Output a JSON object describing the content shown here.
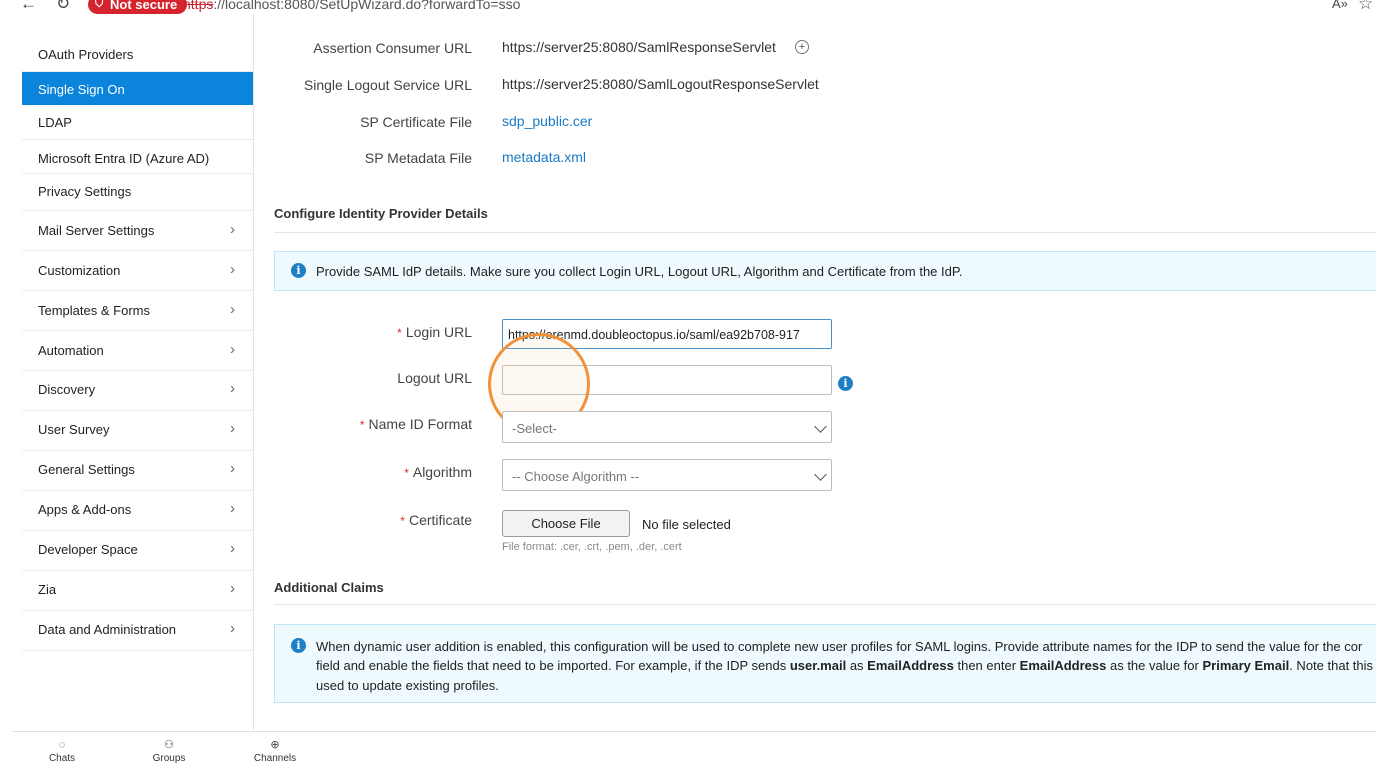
{
  "browser": {
    "security_badge": "Not secure",
    "url_scheme": "https",
    "url_rest": "://localhost:8080/SetUpWizard.do?forwardTo=sso"
  },
  "sidebar": {
    "items": [
      {
        "label": "OAuth Providers"
      },
      {
        "label": "Single Sign On",
        "active": true
      },
      {
        "label": "LDAP"
      },
      {
        "label": "Microsoft Entra ID (Azure AD)"
      },
      {
        "label": "Privacy Settings"
      },
      {
        "label": "Mail Server Settings",
        "expandable": true
      },
      {
        "label": "Customization",
        "expandable": true
      },
      {
        "label": "Templates & Forms",
        "expandable": true
      },
      {
        "label": "Automation",
        "expandable": true
      },
      {
        "label": "Discovery",
        "expandable": true
      },
      {
        "label": "User Survey",
        "expandable": true
      },
      {
        "label": "General Settings",
        "expandable": true
      },
      {
        "label": "Apps & Add-ons",
        "expandable": true
      },
      {
        "label": "Developer Space",
        "expandable": true
      },
      {
        "label": "Zia",
        "expandable": true
      },
      {
        "label": "Data and Administration",
        "expandable": true
      }
    ]
  },
  "sp_details": {
    "acs_label": "Assertion Consumer URL",
    "acs_value": "https://server25:8080/SamlResponseServlet",
    "slo_label": "Single Logout Service URL",
    "slo_value": "https://server25:8080/SamlLogoutResponseServlet",
    "cert_label": "SP Certificate File",
    "cert_link": "sdp_public.cer",
    "metadata_label": "SP Metadata File",
    "metadata_link": "metadata.xml"
  },
  "idp": {
    "section_title": "Configure Identity Provider Details",
    "info": "Provide SAML IdP details. Make sure you collect Login URL, Logout URL, Algorithm and Certificate from the IdP.",
    "login_url_label": "Login URL",
    "login_url_value": "https://orenmd.doubleoctopus.io/saml/ea92b708-917",
    "logout_url_label": "Logout URL",
    "logout_url_value": "",
    "name_id_label": "Name ID Format",
    "name_id_value": "-Select-",
    "algorithm_label": "Algorithm",
    "algorithm_value": "-- Choose Algorithm --",
    "certificate_label": "Certificate",
    "choose_file_label": "Choose File",
    "no_file_text": "No file selected",
    "file_format_hint": "File format: .cer, .crt, .pem, .der, .cert"
  },
  "claims": {
    "section_title": "Additional Claims",
    "info_line1": "When dynamic user addition is enabled, this configuration will be used to complete new user profiles for SAML logins. Provide attribute names for the IDP to send the value for the cor",
    "info_line2_a": "field and enable the fields that need to be imported. For example, if the IDP sends ",
    "info_line2_b": "user.mail",
    "info_line2_c": " as ",
    "info_line2_d": "EmailAddress",
    "info_line2_e": " then enter ",
    "info_line2_f": "EmailAddress",
    "info_line2_g": " as the value for ",
    "info_line2_h": "Primary Email",
    "info_line2_i": ". Note that this con",
    "info_line3": "used to update existing profiles."
  },
  "bottom_bar": {
    "chats": "Chats",
    "groups": "Groups",
    "channels": "Channels"
  },
  "colors": {
    "accent": "#0b84db",
    "link": "#1a7ac2",
    "required": "#d62c2c",
    "highlight_circle": "#f0923a",
    "not_secure": "#d6242e"
  }
}
